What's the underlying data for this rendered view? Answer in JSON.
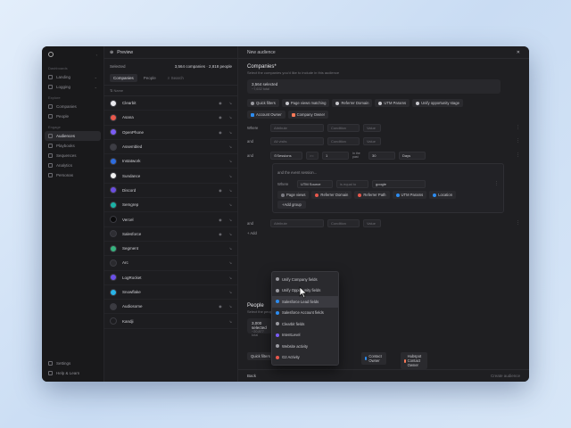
{
  "sidebar": {
    "sections": [
      {
        "title": "Dashboards",
        "items": [
          "Landing",
          "Logging"
        ]
      },
      {
        "title": "Explore",
        "items": [
          "Companies",
          "People"
        ]
      },
      {
        "title": "Engage",
        "items": [
          "Audiences",
          "Playbooks",
          "Sequences",
          "Analytics",
          "Personas"
        ]
      }
    ],
    "active": "Audiences",
    "bottom": [
      "Settings",
      "Help & Learn"
    ]
  },
  "preview": {
    "title": "Preview",
    "selected_label": "Selected",
    "selected_value": "3,564 companies · 2,818 people",
    "tabs": [
      "Companies",
      "People"
    ],
    "search_placeholder": "Search",
    "column": "Name",
    "companies": [
      {
        "name": "Clearbit",
        "color": "#e9e9ee"
      },
      {
        "name": "Asana",
        "color": "#e8584c"
      },
      {
        "name": "OpenPhone",
        "color": "#7b5cf5"
      },
      {
        "name": "Assembled",
        "color": "#3d3d44"
      },
      {
        "name": "Instatwork",
        "color": "#2d6cdf"
      },
      {
        "name": "Sundance",
        "color": "#f0f0f0"
      },
      {
        "name": "Discord",
        "color": "#6c4ee0"
      },
      {
        "name": "Semgrep",
        "color": "#1bb3a6"
      },
      {
        "name": "Vercel",
        "color": "#0b0b0c"
      },
      {
        "name": "Salesforce",
        "color": "#2e2e33"
      },
      {
        "name": "Segment",
        "color": "#36b37e"
      },
      {
        "name": "Arc",
        "color": "#2a2a2e"
      },
      {
        "name": "LogRocket",
        "color": "#6b50e8"
      },
      {
        "name": "Snowflake",
        "color": "#29b5e8"
      },
      {
        "name": "Audiosome",
        "color": "#3b3b41"
      },
      {
        "name": "Kandji",
        "color": "#1d1d20"
      }
    ]
  },
  "main": {
    "header_title": "New audience",
    "section_title": "Companies*",
    "section_subtitle": "Select the companies you'd like to include in this audience",
    "selected_count": "3,564 selected",
    "selected_sub": "~7,632 total",
    "filter_chips": [
      "Quick filters",
      "Page views matching",
      "Referrer Domain",
      "UTM Params",
      "Unify opportunity stage"
    ],
    "owner_chips": [
      "Account Owner",
      "Company Owner"
    ],
    "rows": [
      {
        "label": "Where",
        "attribute": "Attribute",
        "condition": "Condition",
        "value": "Value"
      },
      {
        "label": "and",
        "attribute": "All visits",
        "condition": "Condition",
        "value": "Value"
      }
    ],
    "sessions_row": {
      "label": "and",
      "field": "Sessions",
      "op": ">=",
      "num": "1",
      "window_label": "In the past",
      "window": "30",
      "unit": "Days"
    },
    "nested": {
      "text": "and the event session...",
      "where": "Where",
      "attr": "UTM Source",
      "cond": "is equal to",
      "val": "google",
      "chips": [
        "Page views",
        "Referrer Domain",
        "Referrer Path",
        "UTM Params",
        "Location"
      ],
      "add_group": "Add group"
    },
    "last_row": {
      "label": "and",
      "attribute": "Attribute",
      "condition": "Condition",
      "value": "Value"
    },
    "add_label": "Add",
    "dropdown": [
      "Unify Company fields",
      "Unify Opportunity fields",
      "Salesforce Lead fields",
      "Salesforce Account fields",
      "Clearbit fields",
      "IntentLevel",
      "Website activity",
      "G2 Activity"
    ],
    "dropdown_highlight": 2,
    "people": {
      "title": "People",
      "subtitle": "Select the people",
      "count": "3,000 selected",
      "count_sub": "~20,877 total",
      "quick": "Quick filters",
      "owners": [
        "Contact Owner",
        "Hubspot Contact Owner"
      ]
    },
    "footer_back": "Back",
    "footer_create": "Create audience"
  }
}
